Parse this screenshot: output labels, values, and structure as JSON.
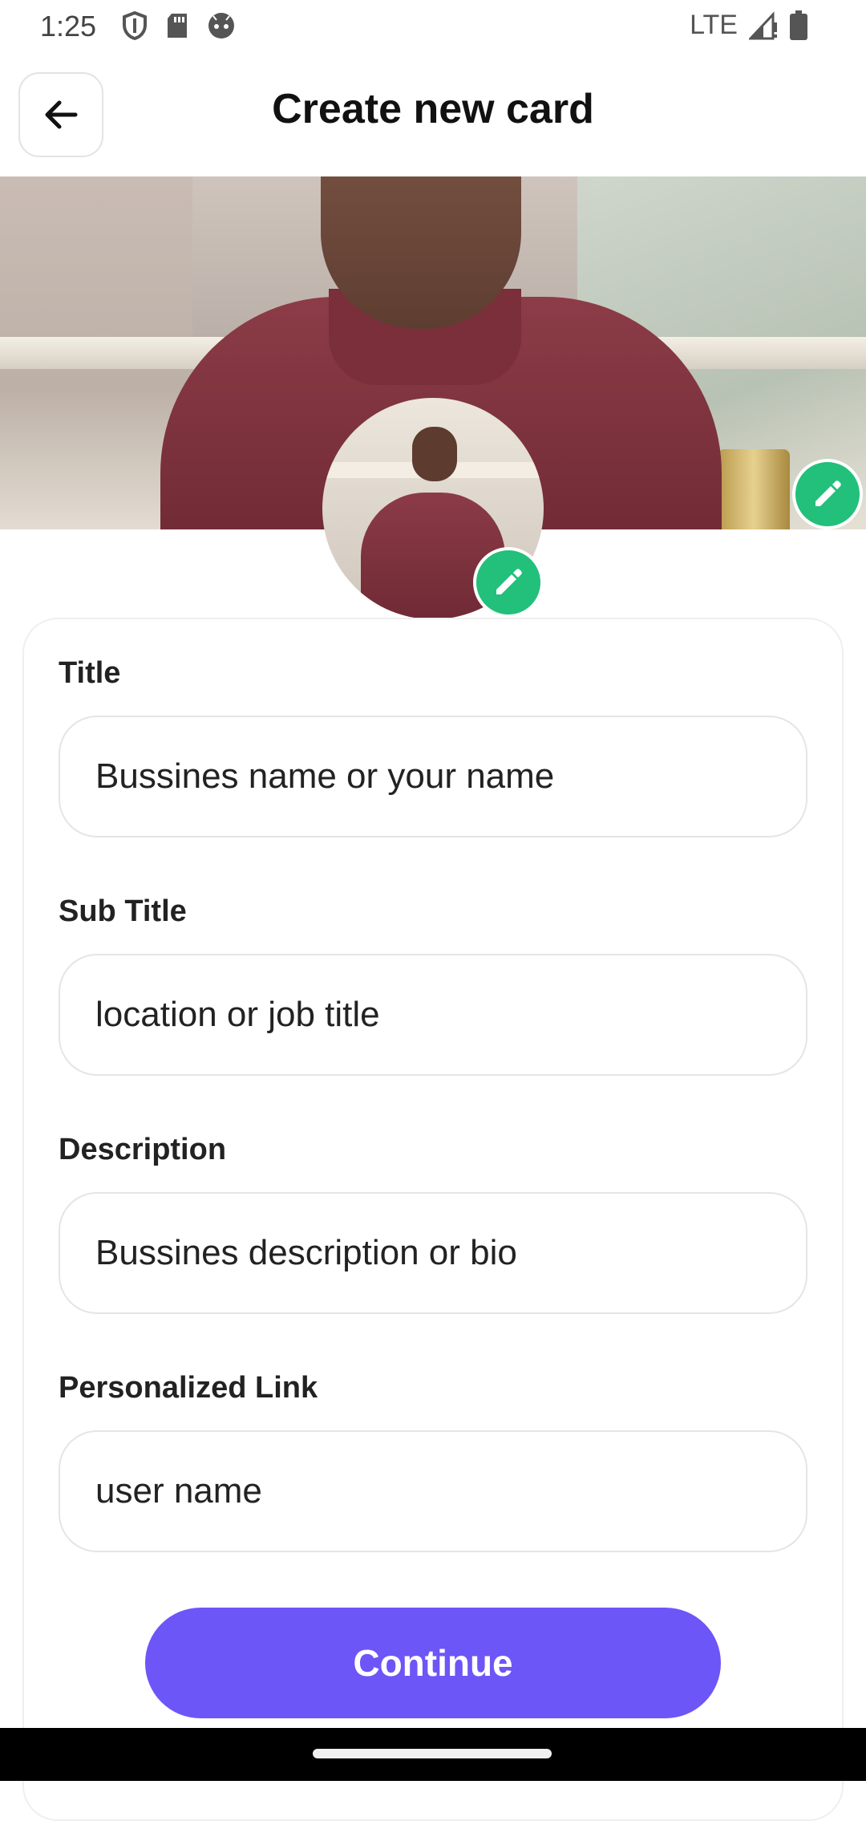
{
  "status_bar": {
    "time": "1:25",
    "network": "LTE",
    "icons_left": [
      "shield-icon",
      "sd-card-icon",
      "android-face-icon"
    ],
    "icons_right": [
      "signal-icon",
      "battery-icon"
    ]
  },
  "header": {
    "title": "Create new card",
    "back_icon": "arrow-left-icon"
  },
  "cover": {
    "edit_icon": "pencil-icon"
  },
  "avatar": {
    "edit_icon": "pencil-icon"
  },
  "form": {
    "fields": [
      {
        "label": "Title",
        "placeholder": "Bussines name or your name",
        "value": ""
      },
      {
        "label": "Sub Title",
        "placeholder": "location or job title",
        "value": ""
      },
      {
        "label": "Description",
        "placeholder": "Bussines description or bio",
        "value": ""
      },
      {
        "label": "Personalized Link",
        "placeholder": "user name",
        "value": ""
      }
    ],
    "continue_label": "Continue"
  },
  "colors": {
    "accent": "#6c56f7",
    "edit_green": "#22c07a"
  }
}
